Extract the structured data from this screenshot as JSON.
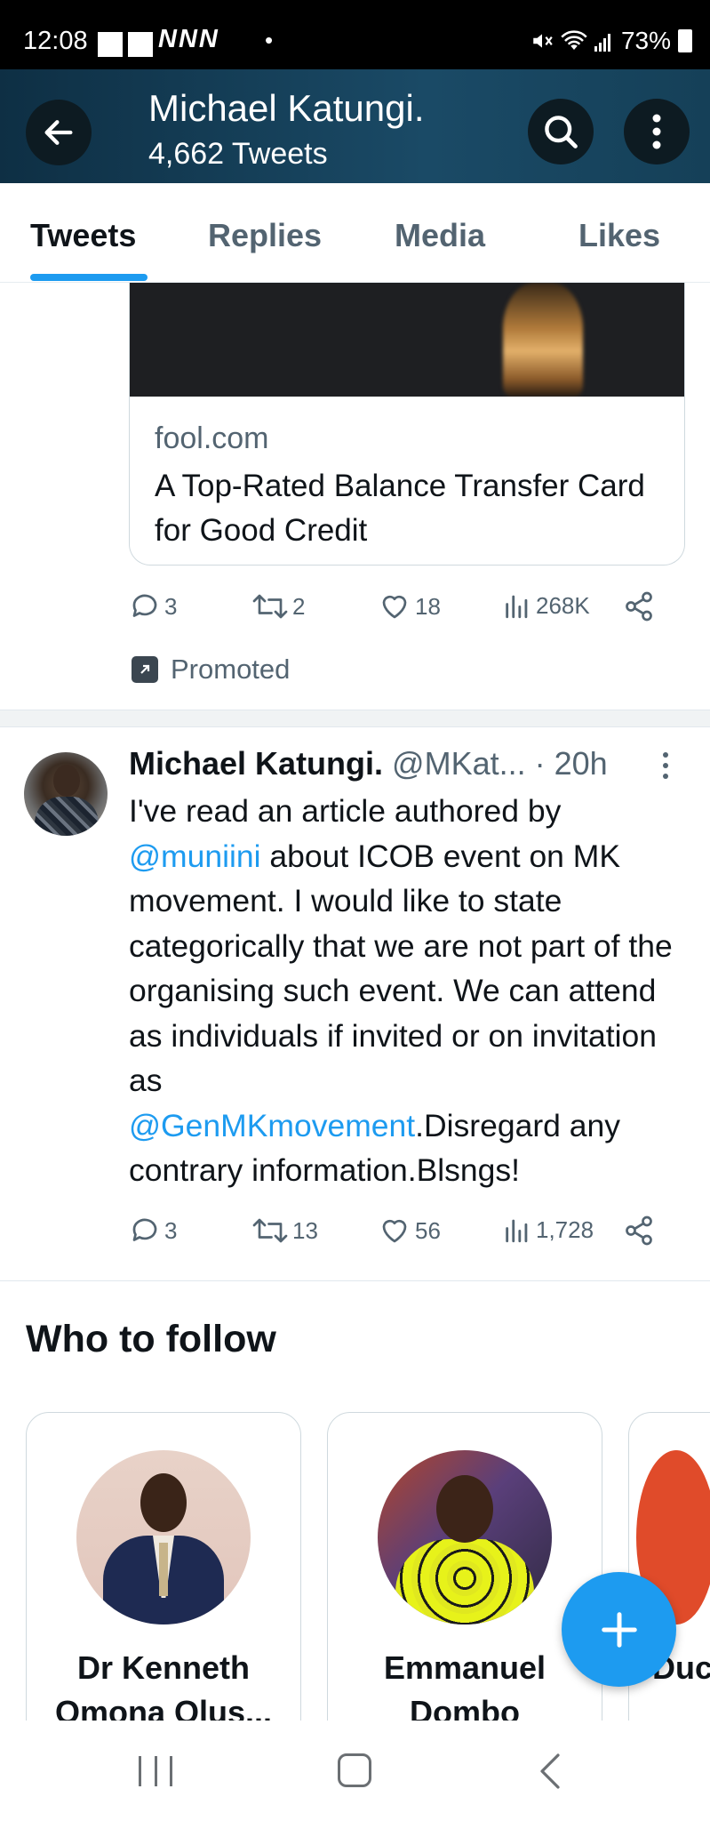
{
  "status_bar": {
    "time": "12:08",
    "carrier_marks": "NNN",
    "dot": "•",
    "battery": "73%"
  },
  "header": {
    "title": "Michael Katungi.",
    "subtitle": "4,662 Tweets"
  },
  "tabs": [
    {
      "label": "Tweets",
      "active": true
    },
    {
      "label": "Replies",
      "active": false
    },
    {
      "label": "Media",
      "active": false
    },
    {
      "label": "Likes",
      "active": false
    }
  ],
  "promoted_tweet": {
    "card": {
      "domain": "fool.com",
      "title": "A Top-Rated Balance Transfer Card for Good Credit"
    },
    "actions": {
      "replies": "3",
      "retweets": "2",
      "likes": "18",
      "views": "268K"
    },
    "promoted_label": "Promoted"
  },
  "tweet": {
    "name": "Michael Katungi.",
    "handle": "@MKat...",
    "time": "· 20h",
    "text_part1": "I've  read an article authored by",
    "mention1": "@muniini",
    "text_part2": " about ICOB event on MK movement. I would like to state categorically that we are not part of the organising such event. We can attend as individuals if invited or on invitation as",
    "mention2": "@GenMKmovement",
    "text_part3": ".Disregard any contrary information.Blsngs!",
    "actions": {
      "replies": "3",
      "retweets": "13",
      "likes": "56",
      "views": "1,728"
    }
  },
  "who_to_follow": {
    "title": "Who to follow",
    "people": [
      {
        "name": "Dr Kenneth Omona Olus..."
      },
      {
        "name": "Emmanuel Dombo"
      },
      {
        "name": "Duc"
      }
    ]
  },
  "colors": {
    "accent": "#1d9bf0",
    "header_bg": "#0e2f44",
    "secondary_text": "#536471"
  },
  "icons": [
    "back-arrow-icon",
    "search-icon",
    "more-vertical-icon",
    "reply-icon",
    "retweet-icon",
    "like-icon",
    "views-icon",
    "share-icon",
    "promoted-icon",
    "compose-plus-icon",
    "nav-recent-icon",
    "nav-home-icon",
    "nav-back-icon"
  ]
}
